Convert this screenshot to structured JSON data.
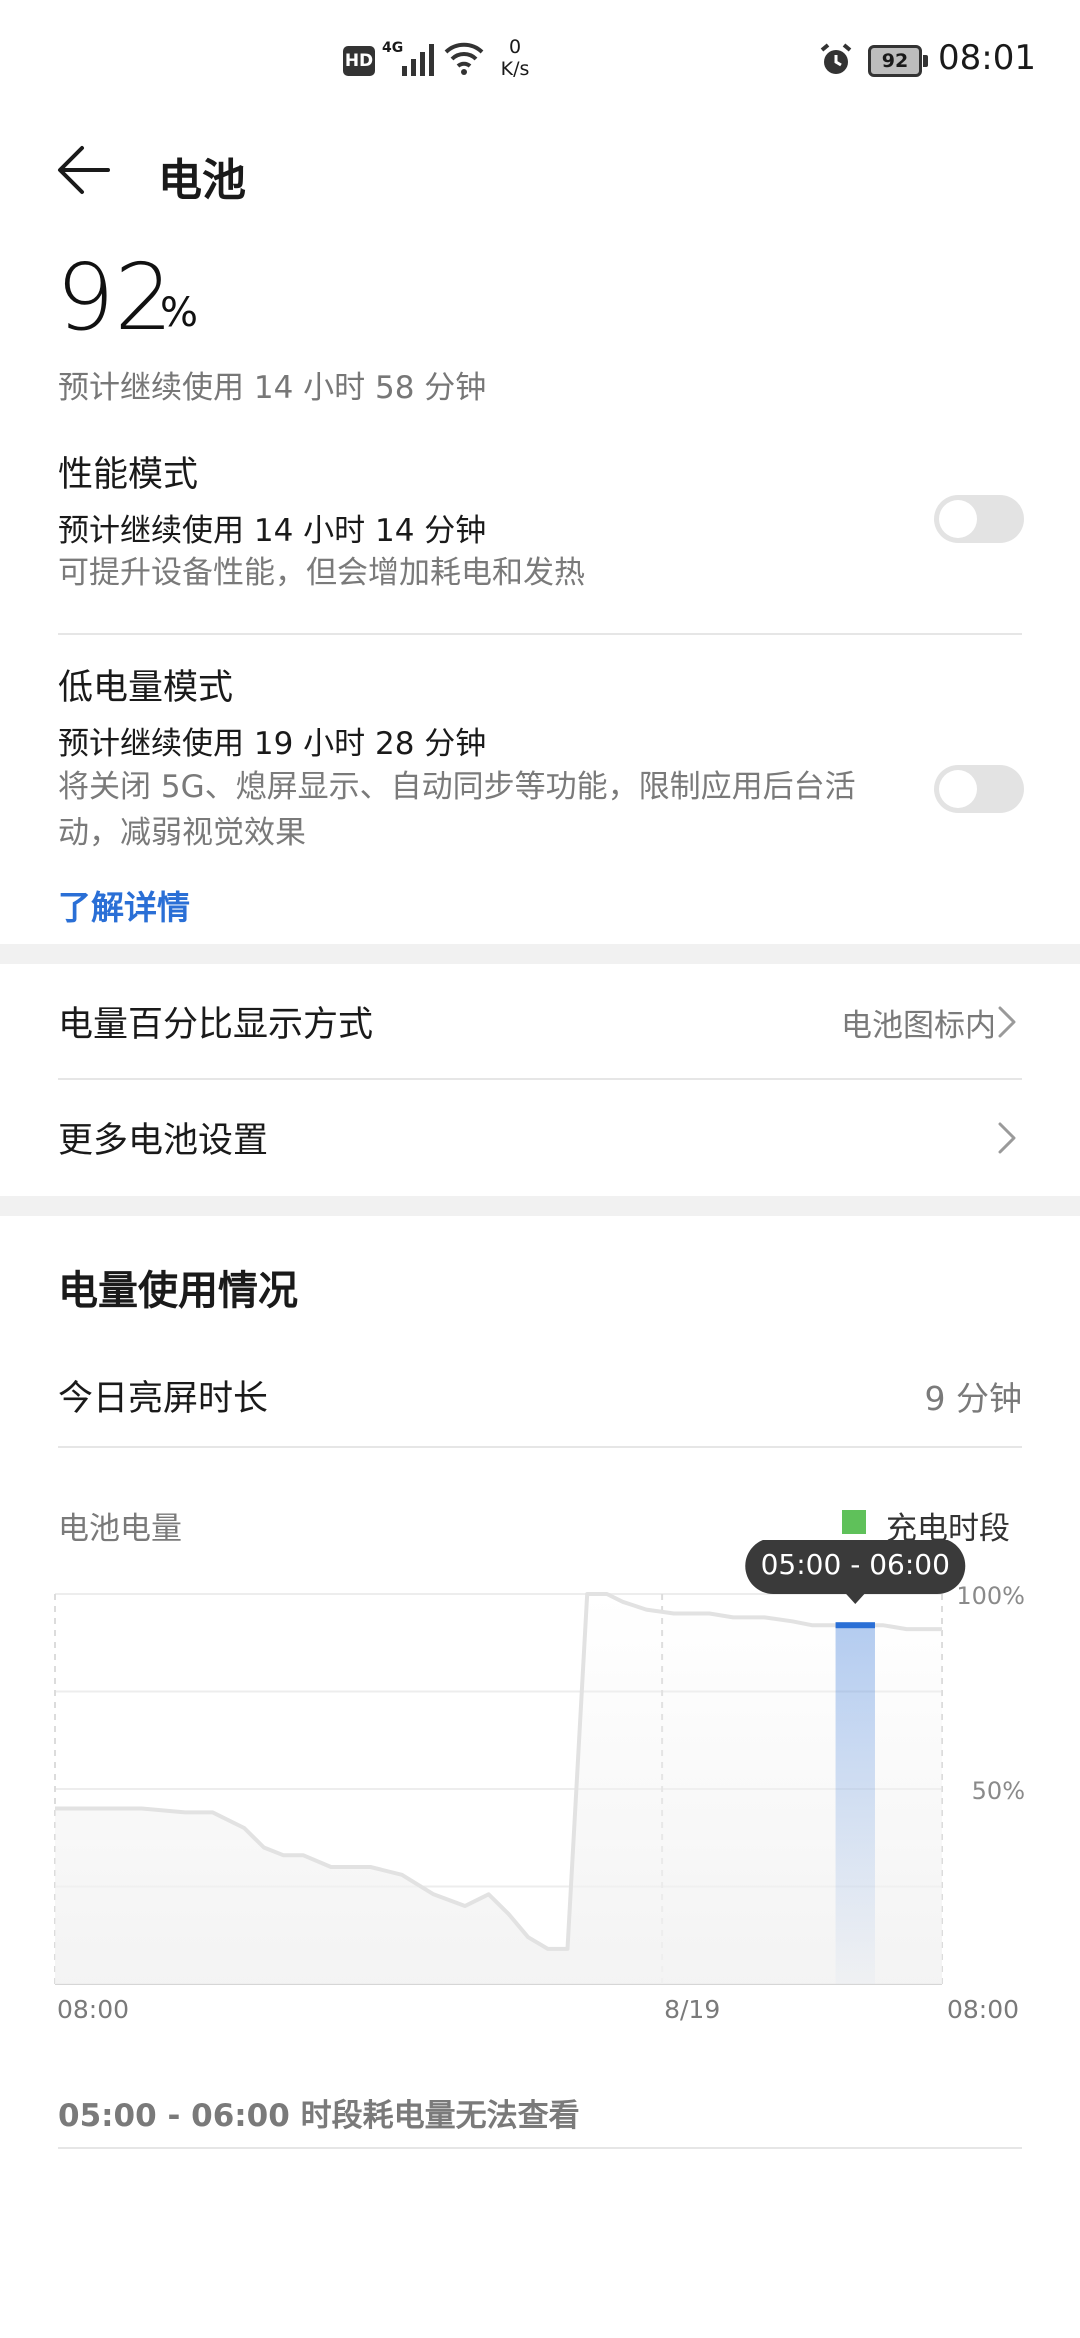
{
  "status_bar": {
    "hd": "HD",
    "network": "4G",
    "speed_value": "0",
    "speed_unit": "K/s",
    "battery_level": "92",
    "time": "08:01"
  },
  "header": {
    "title": "电池"
  },
  "battery": {
    "percent": "92",
    "percent_unit": "%",
    "remaining": "预计继续使用 14 小时 58 分钟"
  },
  "performance_mode": {
    "title": "性能模式",
    "remaining": "预计继续使用 14 小时 14 分钟",
    "description": "可提升设备性能，但会增加耗电和发热",
    "enabled": false
  },
  "low_power_mode": {
    "title": "低电量模式",
    "remaining": "预计继续使用 19 小时 28 分钟",
    "description": "将关闭 5G、熄屏显示、自动同步等功能，限制应用后台活动，减弱视觉效果",
    "enabled": false,
    "learn_more": "了解详情"
  },
  "settings": {
    "percentage_display": {
      "label": "电量百分比显示方式",
      "value": "电池图标内"
    },
    "more_settings": {
      "label": "更多电池设置"
    }
  },
  "usage": {
    "title": "电量使用情况",
    "screen_on_label": "今日亮屏时长",
    "screen_on_value": "9 分钟",
    "footnote": "05:00 - 06:00 时段耗电量无法查看"
  },
  "chart_data": {
    "type": "area",
    "title": "电池电量",
    "legend": [
      {
        "name": "充电时段",
        "color": "#5fc15a"
      }
    ],
    "tooltip": "05:00 - 06:00",
    "x_tick_labels": [
      "08:00",
      "8/19",
      "08:00"
    ],
    "y_tick_labels": [
      "100%",
      "50%"
    ],
    "ylim": [
      0,
      100
    ],
    "series": [
      {
        "x": [
          0,
          1.1,
          2.2,
          3.3,
          4.0,
          4.8,
          5.3,
          5.8,
          6.3,
          7.0,
          8.0,
          8.8,
          9.6,
          10.4,
          11.0,
          11.5,
          12.0,
          12.5,
          13.0,
          13.5,
          14.0,
          14.4,
          15.0,
          15.7,
          16.2,
          16.6,
          17.2,
          18.0,
          18.7,
          19.2,
          19.8,
          20.4,
          21.0,
          21.6,
          22.2,
          22.5
        ],
        "y": [
          45,
          45,
          45,
          44,
          44,
          40,
          35,
          33,
          33,
          30,
          30,
          28,
          23,
          20,
          23,
          18,
          12,
          9,
          9,
          100,
          100,
          98,
          96,
          95,
          95,
          95,
          94,
          94,
          93,
          92,
          92,
          92,
          92,
          91,
          91,
          91
        ],
        "color": "#e2e2e2"
      }
    ],
    "highlight_band": {
      "x_start": 19.8,
      "x_end": 20.8,
      "level": 92,
      "color": "#2a6fd6"
    },
    "grid": true
  }
}
